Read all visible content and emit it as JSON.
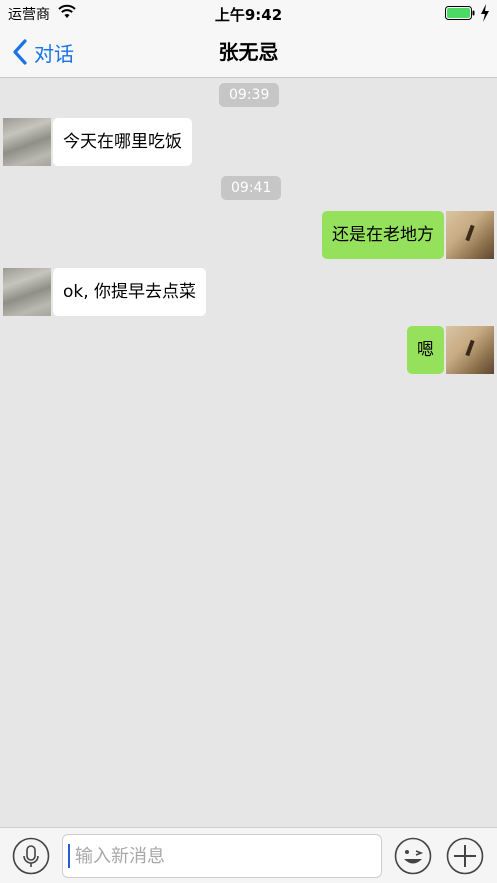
{
  "status_bar": {
    "carrier": "运营商",
    "time": "上午9:42"
  },
  "nav": {
    "back_label": "对话",
    "title": "张无忌"
  },
  "messages": [
    {
      "type": "time",
      "text": "09:39"
    },
    {
      "type": "incoming",
      "text": "今天在哪里吃饭"
    },
    {
      "type": "time",
      "text": "09:41"
    },
    {
      "type": "outgoing",
      "text": "还是在老地方"
    },
    {
      "type": "incoming",
      "text": "ok, 你提早去点菜"
    },
    {
      "type": "outgoing",
      "text": "嗯"
    }
  ],
  "input": {
    "placeholder": "输入新消息",
    "value": ""
  },
  "icons": {
    "mic": "microphone-icon",
    "emoji": "emoji-icon",
    "plus": "plus-icon",
    "back": "chevron-left-icon"
  },
  "colors": {
    "accent": "#1a73e8",
    "outgoing_bubble": "#95e15c",
    "incoming_bubble": "#ffffff",
    "background": "#e6e6e6"
  }
}
